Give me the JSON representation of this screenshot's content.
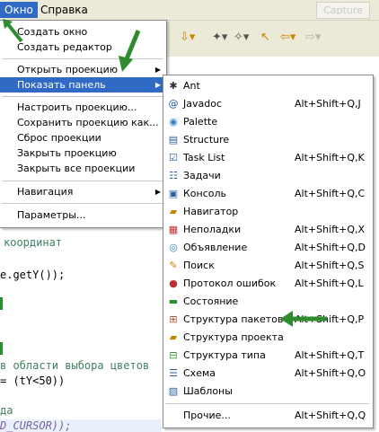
{
  "menubar": {
    "items": [
      "Окно",
      "Справка"
    ],
    "capture_label": "Capture"
  },
  "window_menu": {
    "group1": [
      "Создать окно",
      "Создать редактор"
    ],
    "open_perspective": "Открыть проекцию",
    "show_view": "Показать панель",
    "group3": [
      "Настроить проекцию...",
      "Сохранить проекцию как...",
      "Сброс проекции",
      "Закрыть проекцию",
      "Закрыть все проекции"
    ],
    "navigation": "Навигация",
    "preferences": "Параметры..."
  },
  "show_view_menu": [
    {
      "label": "Ant",
      "shortcut": "",
      "icon": "ant-icon"
    },
    {
      "label": "Javadoc",
      "shortcut": "Alt+Shift+Q,J",
      "icon": "at-icon"
    },
    {
      "label": "Palette",
      "shortcut": "",
      "icon": "palette-icon"
    },
    {
      "label": "Structure",
      "shortcut": "",
      "icon": "structure-icon"
    },
    {
      "label": "Task List",
      "shortcut": "Alt+Shift+Q,K",
      "icon": "task-list-icon"
    },
    {
      "label": "Задачи",
      "shortcut": "",
      "icon": "tasks-icon"
    },
    {
      "label": "Консоль",
      "shortcut": "Alt+Shift+Q,C",
      "icon": "console-icon"
    },
    {
      "label": "Навигатор",
      "shortcut": "",
      "icon": "navigator-icon"
    },
    {
      "label": "Неполадки",
      "shortcut": "Alt+Shift+Q,X",
      "icon": "problems-icon"
    },
    {
      "label": "Объявление",
      "shortcut": "Alt+Shift+Q,D",
      "icon": "declaration-icon"
    },
    {
      "label": "Поиск",
      "shortcut": "Alt+Shift+Q,S",
      "icon": "search-icon"
    },
    {
      "label": "Протокол ошибок",
      "shortcut": "Alt+Shift+Q,L",
      "icon": "error-log-icon"
    },
    {
      "label": "Состояние",
      "shortcut": "",
      "icon": "progress-icon"
    },
    {
      "label": "Структура пакетов",
      "shortcut": "Alt+Shift+Q,P",
      "icon": "package-explorer-icon"
    },
    {
      "label": "Структура проекта",
      "shortcut": "",
      "icon": "project-explorer-icon"
    },
    {
      "label": "Структура типа",
      "shortcut": "Alt+Shift+Q,T",
      "icon": "type-hierarchy-icon"
    },
    {
      "label": "Схема",
      "shortcut": "Alt+Shift+Q,O",
      "icon": "outline-icon"
    },
    {
      "label": "Шаблоны",
      "shortcut": "",
      "icon": "templates-icon"
    },
    {
      "label": "Прочие...",
      "shortcut": "Alt+Shift+Q,Q",
      "icon": ""
    }
  ],
  "editor": {
    "lines": [
      "координат",
      "e.getY());",
      "",
      "в области выбора цветов",
      "= (tY<50))",
      "",
      "да",
      "D_CURSOR));"
    ]
  },
  "colors": {
    "highlight": "#316ac5",
    "comment": "#3f7f5f",
    "arrow": "#2e8b2e"
  }
}
